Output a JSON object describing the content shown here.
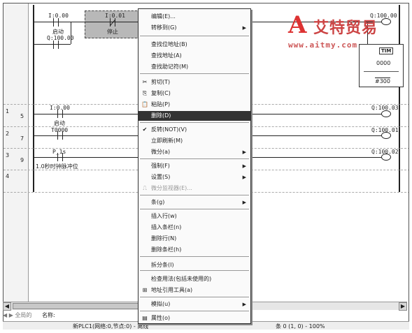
{
  "ladder": {
    "rungs": [
      {
        "rung": "1",
        "step": "5"
      },
      {
        "rung": "2",
        "step": "7"
      },
      {
        "rung": "3",
        "step": "9"
      },
      {
        "rung": "4",
        "step": ""
      }
    ],
    "contacts": [
      {
        "addr": "I:0.00",
        "name": "启动"
      },
      {
        "addr": "I:0.01",
        "name": "停止"
      },
      {
        "addr": "Q:100.00",
        "name": ""
      },
      {
        "addr": "I:0.00",
        "name": "启动"
      },
      {
        "addr": "T0000",
        "name": ""
      },
      {
        "addr": "P_1s",
        "name": "1.0秒时钟脉冲位"
      }
    ],
    "coils": [
      {
        "addr": "Q:100.00"
      },
      {
        "addr": "Q:100.03"
      },
      {
        "addr": "Q:100.01"
      },
      {
        "addr": "Q:100.02"
      }
    ],
    "instr": {
      "name": "TIM",
      "num": "0000",
      "set": "#300"
    }
  },
  "watermark": {
    "title": "艾特贸易",
    "url": "www.aitmy.com"
  },
  "context_menu": [
    {
      "label": "编辑(E)...",
      "sub": false,
      "icon": "",
      "state": "normal"
    },
    {
      "label": "转移到(G)",
      "sub": true,
      "icon": "",
      "state": "normal"
    },
    {
      "label": "查找位地址(B)",
      "sub": false,
      "icon": "",
      "state": "normal"
    },
    {
      "label": "查找地址(A)",
      "sub": false,
      "icon": "",
      "state": "normal"
    },
    {
      "label": "查找助记符(M)",
      "sub": false,
      "icon": "",
      "state": "normal"
    },
    {
      "label": "剪切(T)",
      "sub": false,
      "icon": "✂",
      "state": "normal"
    },
    {
      "label": "复制(C)",
      "sub": false,
      "icon": "⎘",
      "state": "normal"
    },
    {
      "label": "粘贴(P)",
      "sub": false,
      "icon": "📋",
      "state": "normal"
    },
    {
      "label": "删除(D)",
      "sub": false,
      "icon": "",
      "state": "highlight"
    },
    {
      "label": "反转(NOT)(V)",
      "sub": false,
      "icon": "✔",
      "state": "normal"
    },
    {
      "label": "立即刷新(M)",
      "sub": false,
      "icon": "",
      "state": "normal"
    },
    {
      "label": "微分(a)",
      "sub": true,
      "icon": "",
      "state": "normal"
    },
    {
      "label": "强制(F)",
      "sub": true,
      "icon": "",
      "state": "normal"
    },
    {
      "label": "设置(S)",
      "sub": true,
      "icon": "",
      "state": "normal"
    },
    {
      "label": "微分监视器(E)...",
      "sub": false,
      "icon": "⎍",
      "state": "disabled"
    },
    {
      "label": "条(g)",
      "sub": true,
      "icon": "",
      "state": "normal"
    },
    {
      "label": "插入行(w)",
      "sub": false,
      "icon": "",
      "state": "normal"
    },
    {
      "label": "插入条栏(n)",
      "sub": false,
      "icon": "",
      "state": "normal"
    },
    {
      "label": "删除行(N)",
      "sub": false,
      "icon": "",
      "state": "normal"
    },
    {
      "label": "删除条栏(h)",
      "sub": false,
      "icon": "",
      "state": "normal"
    },
    {
      "label": "拆分条(I)",
      "sub": false,
      "icon": "",
      "state": "normal"
    },
    {
      "label": "检查用法(包括未使用的)",
      "sub": false,
      "icon": "",
      "state": "normal"
    },
    {
      "label": "地址引用工具(a)",
      "sub": false,
      "icon": "⊞",
      "state": "normal"
    },
    {
      "label": "模拟(u)",
      "sub": true,
      "icon": "",
      "state": "normal"
    },
    {
      "label": "属性(o)",
      "sub": false,
      "icon": "▤",
      "state": "normal"
    }
  ],
  "tabbar": {
    "tabs": "◀ ▶ 全局的",
    "name_label": "名称:"
  },
  "statusbar": {
    "left": "新PLC1(网络:0,节点:0) - 离线",
    "right": "条 0 (1, 0)  - 100%"
  }
}
